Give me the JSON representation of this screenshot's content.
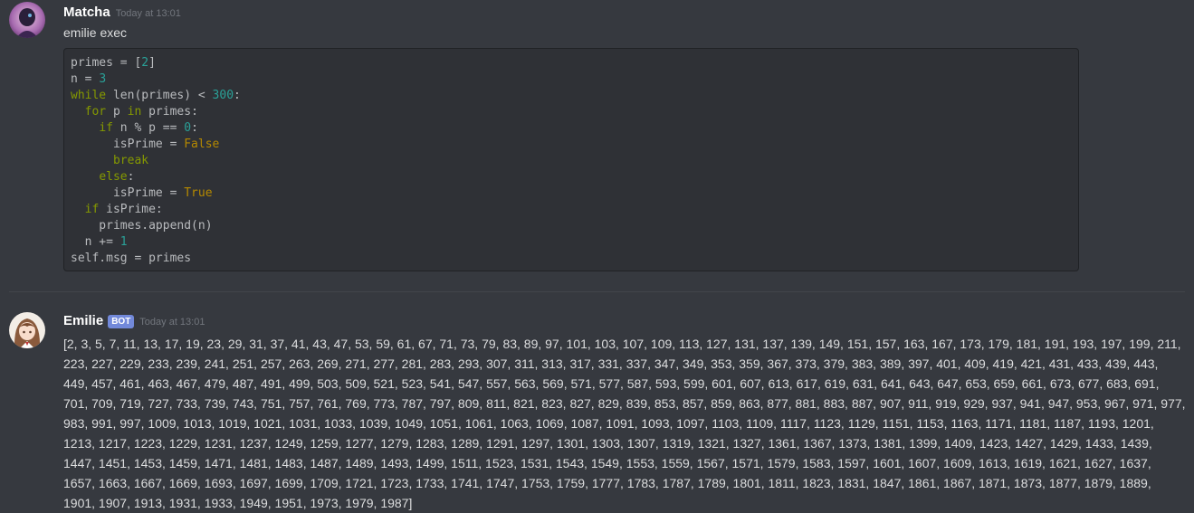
{
  "messages": [
    {
      "author": "Matcha",
      "timestamp": "Today at 13:01",
      "text": "emilie exec",
      "code_lines": [
        "primes = [2]",
        "n = 3",
        "while len(primes) < 300:",
        "  for p in primes:",
        "    if n % p == 0:",
        "      isPrime = False",
        "      break",
        "    else:",
        "      isPrime = True",
        "  if isPrime:",
        "    primes.append(n)",
        "  n += 1",
        "self.msg = primes"
      ]
    },
    {
      "author": "Emilie",
      "bot_tag": "BOT",
      "timestamp": "Today at 13:01",
      "text": "[2, 3, 5, 7, 11, 13, 17, 19, 23, 29, 31, 37, 41, 43, 47, 53, 59, 61, 67, 71, 73, 79, 83, 89, 97, 101, 103, 107, 109, 113, 127, 131, 137, 139, 149, 151, 157, 163, 167, 173, 179, 181, 191, 193, 197, 199, 211, 223, 227, 229, 233, 239, 241, 251, 257, 263, 269, 271, 277, 281, 283, 293, 307, 311, 313, 317, 331, 337, 347, 349, 353, 359, 367, 373, 379, 383, 389, 397, 401, 409, 419, 421, 431, 433, 439, 443, 449, 457, 461, 463, 467, 479, 487, 491, 499, 503, 509, 521, 523, 541, 547, 557, 563, 569, 571, 577, 587, 593, 599, 601, 607, 613, 617, 619, 631, 641, 643, 647, 653, 659, 661, 673, 677, 683, 691, 701, 709, 719, 727, 733, 739, 743, 751, 757, 761, 769, 773, 787, 797, 809, 811, 821, 823, 827, 829, 839, 853, 857, 859, 863, 877, 881, 883, 887, 907, 911, 919, 929, 937, 941, 947, 953, 967, 971, 977, 983, 991, 997, 1009, 1013, 1019, 1021, 1031, 1033, 1039, 1049, 1051, 1061, 1063, 1069, 1087, 1091, 1093, 1097, 1103, 1109, 1117, 1123, 1129, 1151, 1153, 1163, 1171, 1181, 1187, 1193, 1201, 1213, 1217, 1223, 1229, 1231, 1237, 1249, 1259, 1277, 1279, 1283, 1289, 1291, 1297, 1301, 1303, 1307, 1319, 1321, 1327, 1361, 1367, 1373, 1381, 1399, 1409, 1423, 1427, 1429, 1433, 1439, 1447, 1451, 1453, 1459, 1471, 1481, 1483, 1487, 1489, 1493, 1499, 1511, 1523, 1531, 1543, 1549, 1553, 1559, 1567, 1571, 1579, 1583, 1597, 1601, 1607, 1609, 1613, 1619, 1621, 1627, 1637, 1657, 1663, 1667, 1669, 1693, 1697, 1699, 1709, 1721, 1723, 1733, 1741, 1747, 1753, 1759, 1777, 1783, 1787, 1789, 1801, 1811, 1823, 1831, 1847, 1861, 1867, 1871, 1873, 1877, 1879, 1889, 1901, 1907, 1913, 1931, 1933, 1949, 1951, 1973, 1979, 1987]"
    }
  ],
  "colors": {
    "background": "#36393f",
    "code_background": "#2f3136",
    "keyword": "#859900",
    "number": "#2aa198",
    "boolean": "#b58900",
    "bot_tag": "#7289da"
  }
}
